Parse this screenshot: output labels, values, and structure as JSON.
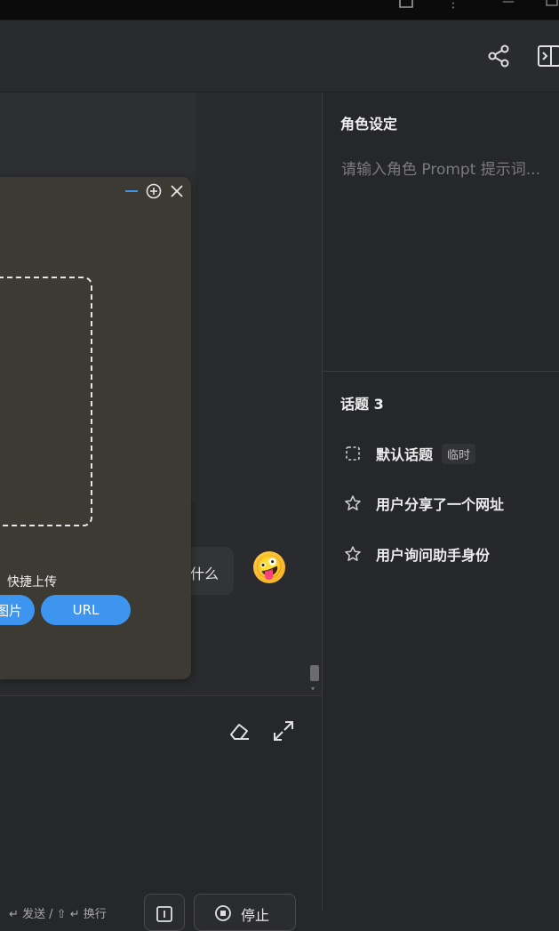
{
  "right_panel": {
    "role_title": "角色设定",
    "role_placeholder": "请输入角色 Prompt 提示词...",
    "topics_title": "话题 3",
    "topics": [
      {
        "label": "默认话题",
        "tag": "临时",
        "icon": "dashed-square-icon"
      },
      {
        "label": "用户分享了一个网址",
        "icon": "star-icon"
      },
      {
        "label": "用户询问助手身份",
        "icon": "star-icon"
      }
    ]
  },
  "chat": {
    "bubble_text": "什么",
    "emoji": "🤪"
  },
  "dialog": {
    "quick_upload_label": "快捷上传",
    "image_button": "图片",
    "url_button": "URL"
  },
  "input": {
    "hint_text": "↵ 发送 / ⇧ ↵ 换行",
    "stop_label": "停止"
  },
  "colors": {
    "accent": "#3d95f0",
    "background": "#26272a",
    "dialog_bg": "#3d3a34"
  }
}
